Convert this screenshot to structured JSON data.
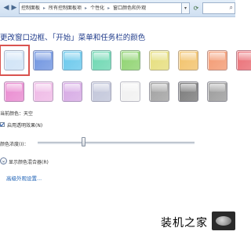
{
  "address_bar": {
    "crumbs": [
      "控制面板",
      "所有控制面板项",
      "个性化",
      "窗口颜色和外观"
    ],
    "separator": "▸"
  },
  "icons": [
    "back-arrow-icon",
    "forward-arrow-icon",
    "chevron-down-icon",
    "refresh-icon",
    "search-icon"
  ],
  "page": {
    "heading": "更改窗口边框、「开始」菜单和任务栏的颜色"
  },
  "swatches": {
    "selected_index": 0,
    "rows": [
      [
        "#cfe3f6",
        "#6f94e0",
        "#69c8ec",
        "#6cd7b1",
        "#8ed36f",
        "#e6de7c",
        "#f2c26a",
        "#f39a72",
        "#ea6f76"
      ],
      [
        "#e98ad0",
        "#efb9e6",
        "#d6a9e4",
        "#c1c5d9",
        "#f1f1f1",
        "#a1a1a1",
        "#7a7a7a",
        "#9b9b9b"
      ]
    ]
  },
  "settings": {
    "current_color_label": "当前颜色：天空",
    "transparency_label": "启用透明效果(N)",
    "transparency_checked": true,
    "intensity_label": "颜色浓度(I)：",
    "intensity_value": 0.29,
    "mixer_label": "显示颜色混合器(R)",
    "advanced_link": "高级外观设置..."
  },
  "watermark": {
    "text": "装机之家"
  }
}
